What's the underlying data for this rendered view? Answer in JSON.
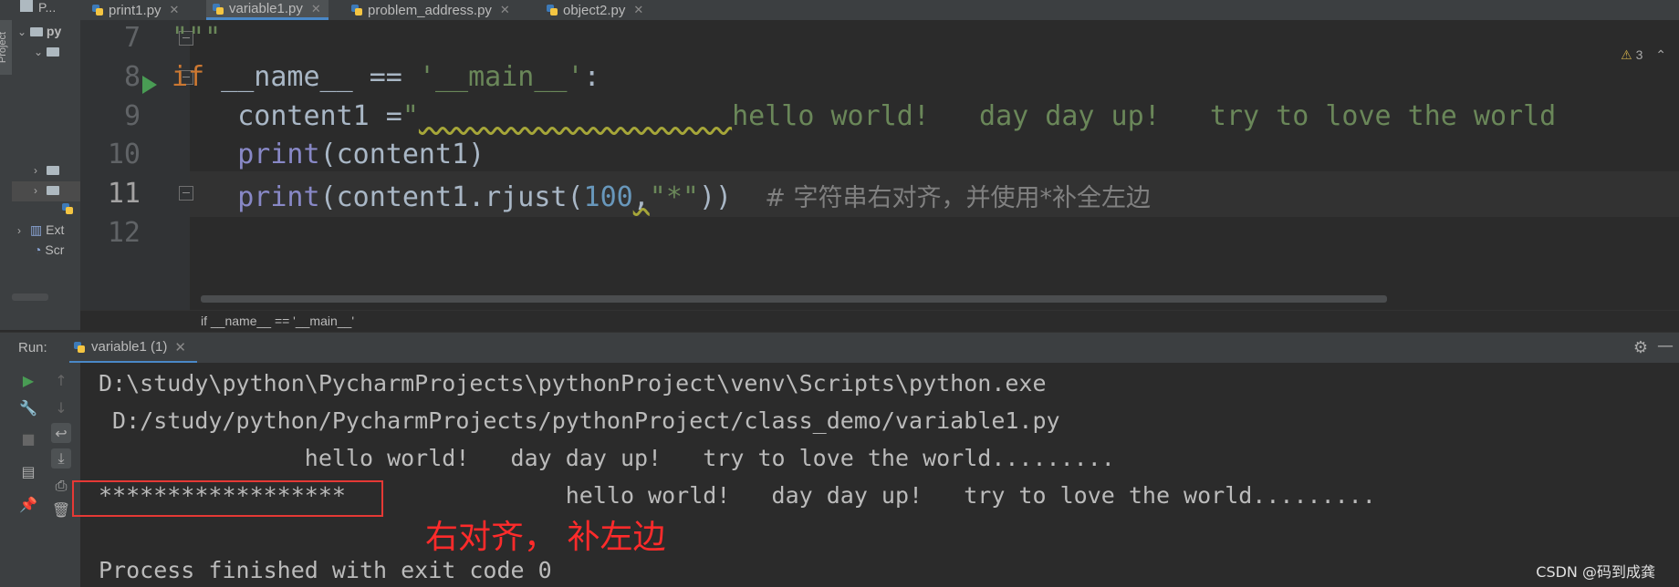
{
  "tabs": [
    {
      "label": "print1.py",
      "active": false
    },
    {
      "label": "variable1.py",
      "active": true
    },
    {
      "label": "problem_address.py",
      "active": false
    },
    {
      "label": "object2.py",
      "active": false
    }
  ],
  "project": {
    "tool_label": "Project",
    "tab_label": "P...",
    "root": "py",
    "external_libraries": "Ext",
    "scratches": "Scr"
  },
  "editor": {
    "warning_count": "3",
    "lines": [
      {
        "no": "7"
      },
      {
        "no": "8"
      },
      {
        "no": "9"
      },
      {
        "no": "10"
      },
      {
        "no": "11"
      },
      {
        "no": "12"
      }
    ],
    "code": {
      "l7": "\"\"\"",
      "l8_kw": "if",
      "l8_rest": " __name__ == ",
      "l8_str": "'__main__'",
      "l8_end": ":",
      "l9_a": "    content1 =",
      "l9_quote": "\"",
      "l9_ws": "                   ",
      "l9_str": "hello world!   day day up!   try to love the world",
      "l10_fn": "print",
      "l10_rest": "(content1)",
      "l11_fn": "print",
      "l11_a": "(content1.rjust(",
      "l11_num": "100",
      "l11_comma": ",",
      "l11_str": "\"*\"",
      "l11_b": "))  ",
      "l11_cmt": "# 字符串右对齐，并使用*补全左边"
    },
    "breadcrumb": "if __name__ == '__main__'"
  },
  "run": {
    "title": "Run:",
    "tab_label": "variable1 (1)",
    "console": [
      "D:\\study\\python\\PycharmProjects\\pythonProject\\venv\\Scripts\\python.exe",
      " D:/study/python/PycharmProjects/pythonProject/class_demo/variable1.py",
      "               hello world!   day day up!   try to love the world.........",
      "******************                hello world!   day day up!   try to love the world.........",
      "",
      "Process finished with exit code 0"
    ]
  },
  "annotation": "右对齐， 补左边",
  "watermark": "CSDN @码到成龚",
  "colors": {
    "accent": "#4a88c7",
    "annotation_red": "#ff2b2b",
    "keyword": "#cc7832",
    "string": "#6a8759",
    "builtin": "#8888c6",
    "number": "#6897bb"
  }
}
